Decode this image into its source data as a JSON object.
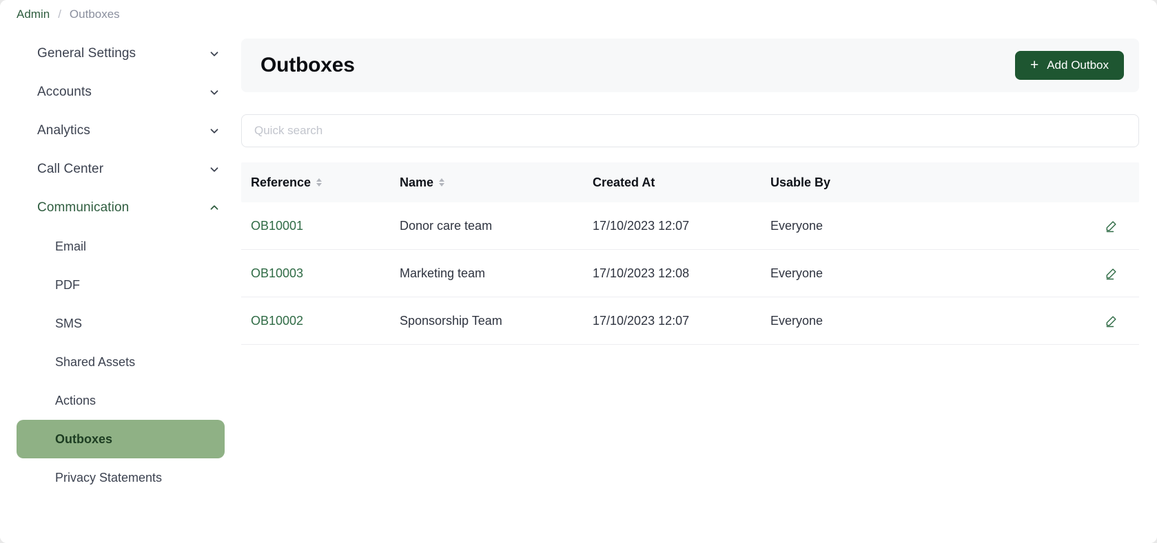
{
  "breadcrumb": {
    "root": "Admin",
    "separator": "/",
    "current": "Outboxes"
  },
  "sidebar": {
    "groups": [
      {
        "label": "General Settings",
        "expanded": false,
        "chevron": "chevron-down-icon"
      },
      {
        "label": "Accounts",
        "expanded": false,
        "chevron": "chevron-down-icon"
      },
      {
        "label": "Analytics",
        "expanded": false,
        "chevron": "chevron-down-icon"
      },
      {
        "label": "Call Center",
        "expanded": false,
        "chevron": "chevron-down-icon"
      },
      {
        "label": "Communication",
        "expanded": true,
        "chevron": "chevron-up-icon"
      }
    ],
    "children": [
      {
        "label": "Email",
        "active": false
      },
      {
        "label": "PDF",
        "active": false
      },
      {
        "label": "SMS",
        "active": false
      },
      {
        "label": "Shared Assets",
        "active": false
      },
      {
        "label": "Actions",
        "active": false
      },
      {
        "label": "Outboxes",
        "active": true
      },
      {
        "label": "Privacy Statements",
        "active": false
      }
    ]
  },
  "header": {
    "title": "Outboxes",
    "add_button_label": "Add Outbox",
    "add_button_icon": "plus-icon"
  },
  "search": {
    "placeholder": "Quick search",
    "value": ""
  },
  "table": {
    "columns": [
      {
        "label": "Reference",
        "sortable": true
      },
      {
        "label": "Name",
        "sortable": true
      },
      {
        "label": "Created At",
        "sortable": false
      },
      {
        "label": "Usable By",
        "sortable": false
      }
    ],
    "rows": [
      {
        "reference": "OB10001",
        "name": "Donor care team",
        "created_at": "17/10/2023 12:07",
        "usable_by": "Everyone",
        "action_icon": "edit-pencil-icon"
      },
      {
        "reference": "OB10003",
        "name": "Marketing team",
        "created_at": "17/10/2023 12:08",
        "usable_by": "Everyone",
        "action_icon": "edit-pencil-icon"
      },
      {
        "reference": "OB10002",
        "name": "Sponsorship Team",
        "created_at": "17/10/2023 12:07",
        "usable_by": "Everyone",
        "action_icon": "edit-pencil-icon"
      }
    ]
  },
  "colors": {
    "accent_dark_green": "#1e5631",
    "active_item_green": "#8fb185",
    "link_green": "#2f6b45",
    "header_card_bg": "#f7f8f9"
  }
}
